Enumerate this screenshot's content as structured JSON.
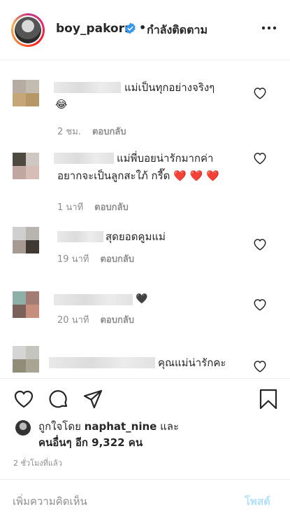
{
  "header": {
    "username": "boy_pakorn",
    "separator": "•",
    "following_label": "กำลังติดตาม"
  },
  "comments": [
    {
      "text": "แม่เป็นทุกอย่างจริงๆ",
      "text2": "😂",
      "time": "2 ชม.",
      "reply": "ตอบกลับ"
    },
    {
      "text": "แม่พี่บอยน่ารักมากค่า",
      "text2": "อยากจะเป็นลูกสะใภ้ กรี๊ด ❤️ ❤️ ❤️",
      "time": "1 นาที",
      "reply": "ตอบกลับ"
    },
    {
      "text": "สุดยอดคูมแม่",
      "time": "19 นาที",
      "reply": "ตอบกลับ"
    },
    {
      "text": "🖤",
      "time": "20 นาที",
      "reply": "ตอบกลับ"
    },
    {
      "text": "คุณแม่น่ารักคะ"
    }
  ],
  "likes": {
    "prefix": "ถูกใจโดย",
    "user": "naphat_nine",
    "suffix": "และ",
    "others": "คนอื่นๆ อีก 9,322 คน"
  },
  "timestamp": "2 ชั่วโมงที่แล้ว",
  "add_comment": {
    "placeholder": "เพิ่มความคิดเห็น",
    "post_label": "โพสต์"
  },
  "colors": {
    "verified": "#3897f0",
    "text": "#262626",
    "muted": "#8e8e8e",
    "post_disabled": "#b2dffc"
  }
}
